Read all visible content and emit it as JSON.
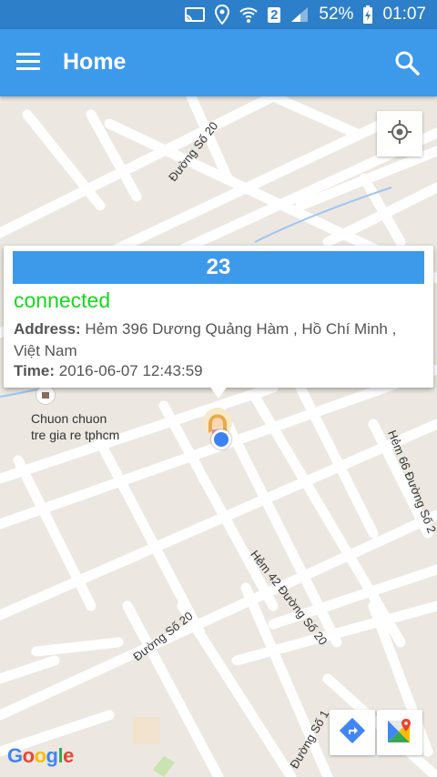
{
  "status_bar": {
    "battery": "52%",
    "time": "01:07",
    "sim": "2"
  },
  "app_bar": {
    "title": "Home"
  },
  "map": {
    "streets": [
      "Đường Số 20",
      "Hẻm 66 Đường Số 2",
      "Hẻm 42 Đường Số 20",
      "Đường Số 20",
      "Đường Số 1"
    ],
    "poi": {
      "line1": "Chuon chuon",
      "line2": "tre gia re tphcm"
    },
    "google_logo": [
      "G",
      "o",
      "o",
      "g",
      "l",
      "e"
    ]
  },
  "info_window": {
    "id": "23",
    "status": "connected",
    "address_label": "Address:",
    "address": "Hẻm 396 Dương Quảng Hàm , Hồ Chí Minh , Việt Nam",
    "time_label": "Time:",
    "time": "2016-06-07 12:43:59"
  },
  "icons": {
    "menu": "menu-icon",
    "search": "search-icon",
    "locate": "my-location-icon",
    "directions": "directions-icon",
    "maps": "google-maps-icon"
  },
  "colors": {
    "accent": "#3d9aeb",
    "connected": "#16d91a",
    "status_bar": "#2d7fc9"
  }
}
